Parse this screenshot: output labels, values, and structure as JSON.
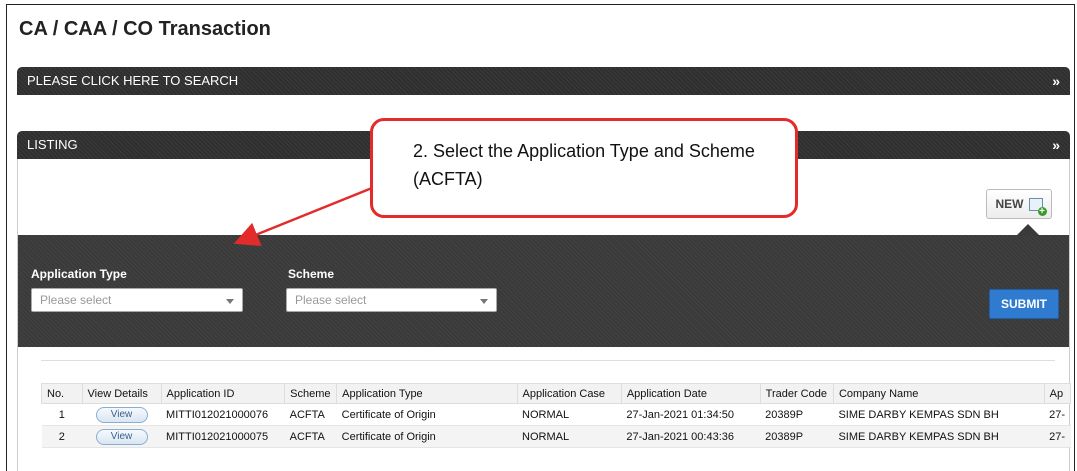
{
  "page_title": "CA / CAA / CO Transaction",
  "search_bar": {
    "label": "PLEASE CLICK HERE TO SEARCH",
    "icon": "double-chevron-down-icon"
  },
  "listing_bar": {
    "label": "LISTING",
    "icon": "double-chevron-down-icon"
  },
  "new_button": {
    "label": "NEW"
  },
  "filter": {
    "application_type_label": "Application Type",
    "application_type_value": "Please select",
    "scheme_label": "Scheme",
    "scheme_value": "Please select",
    "submit_label": "SUBMIT"
  },
  "table": {
    "headers": [
      "No.",
      "View Details",
      "Application ID",
      "Scheme",
      "Application Type",
      "Application Case",
      "Application Date",
      "Trader Code",
      "Company Name",
      "Ap"
    ],
    "rows": [
      {
        "no": "1",
        "view": "View",
        "app_id": "MITTI012021000076",
        "scheme": "ACFTA",
        "app_type": "Certificate of Origin",
        "case": "NORMAL",
        "date": "27-Jan-2021 01:34:50",
        "trader": "20389P",
        "company": "SIME DARBY KEMPAS SDN BH",
        "ap": "27-"
      },
      {
        "no": "2",
        "view": "View",
        "app_id": "MITTI012021000075",
        "scheme": "ACFTA",
        "app_type": "Certificate of Origin",
        "case": "NORMAL",
        "date": "27-Jan-2021 00:43:36",
        "trader": "20389P",
        "company": "SIME DARBY KEMPAS SDN BH",
        "ap": "27-"
      }
    ]
  },
  "callout": {
    "text": "2. Select the Application Type and Scheme (ACFTA)",
    "border_color": "#e32b2b"
  },
  "colors": {
    "bar": "#2f2f2f",
    "submit": "#2e7bd0",
    "callout": "#e32b2b"
  }
}
